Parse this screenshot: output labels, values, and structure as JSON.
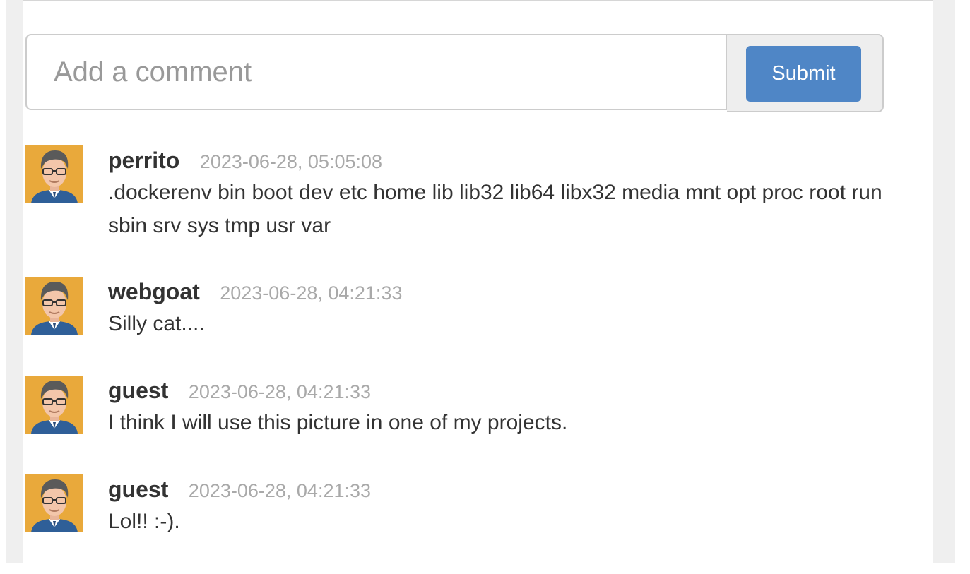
{
  "comment_form": {
    "placeholder": "Add a comment",
    "value": "",
    "submit_label": "Submit",
    "accent_color": "#4f86c6"
  },
  "comments": [
    {
      "author": "perrito",
      "timestamp": "2023-06-28, 05:05:08",
      "text": ".dockerenv bin boot dev etc home lib lib32 lib64 libx32 media mnt opt proc root run sbin srv sys tmp usr var",
      "avatar_icon": "user-avatar-icon"
    },
    {
      "author": "webgoat",
      "timestamp": "2023-06-28, 04:21:33",
      "text": "Silly cat....",
      "avatar_icon": "user-avatar-icon"
    },
    {
      "author": "guest",
      "timestamp": "2023-06-28, 04:21:33",
      "text": "I think I will use this picture in one of my projects.",
      "avatar_icon": "user-avatar-icon"
    },
    {
      "author": "guest",
      "timestamp": "2023-06-28, 04:21:33",
      "text": "Lol!! :-).",
      "avatar_icon": "user-avatar-icon"
    }
  ]
}
